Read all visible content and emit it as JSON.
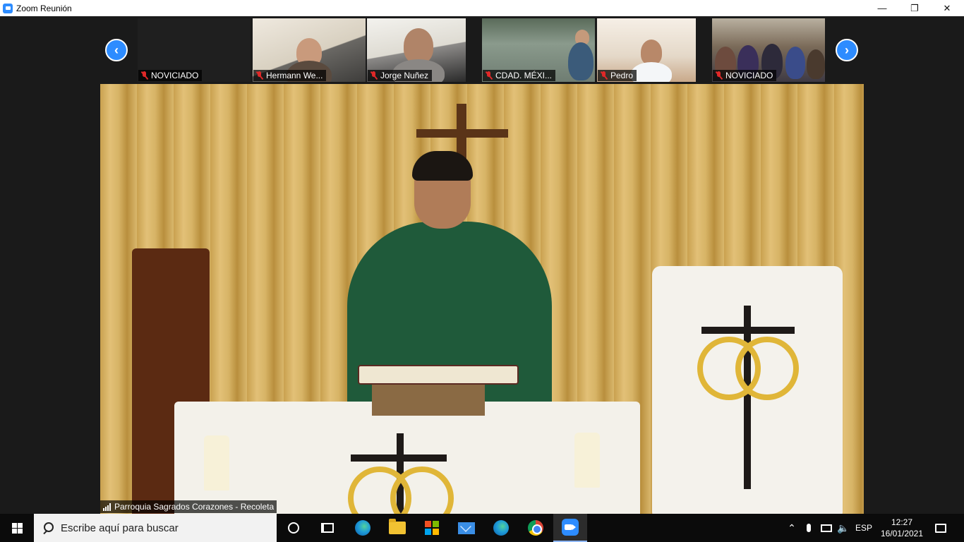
{
  "window": {
    "title": "Zoom Reunión",
    "controls": [
      "minimize",
      "restore",
      "close"
    ]
  },
  "gallery": {
    "prev_icon": "chevron-left-icon",
    "next_icon": "chevron-right-icon",
    "participants": [
      {
        "name": "NOVICIADO",
        "muted": true
      },
      {
        "name": "Hermann We...",
        "muted": true
      },
      {
        "name": "Jorge Nuñez",
        "muted": true
      },
      {
        "name": "CDAD. MÉXI...",
        "muted": true
      },
      {
        "name": "Pedro",
        "muted": true
      },
      {
        "name": "NOVICIADO",
        "muted": true
      }
    ]
  },
  "main_video": {
    "speaker_name": "Parroquia Sagrados Corazones - Recoleta"
  },
  "taskbar": {
    "search_placeholder": "Escribe aquí para buscar",
    "apps": [
      "cortana",
      "task-view",
      "edge",
      "file-explorer",
      "store",
      "mail",
      "edge",
      "chrome",
      "zoom"
    ],
    "active_app": "zoom",
    "language": "ESP",
    "time": "12:27",
    "date": "16/01/2021"
  },
  "colors": {
    "zoom_blue": "#2d8cff",
    "muted_red": "#e02828",
    "background": "#1a1a1a"
  }
}
